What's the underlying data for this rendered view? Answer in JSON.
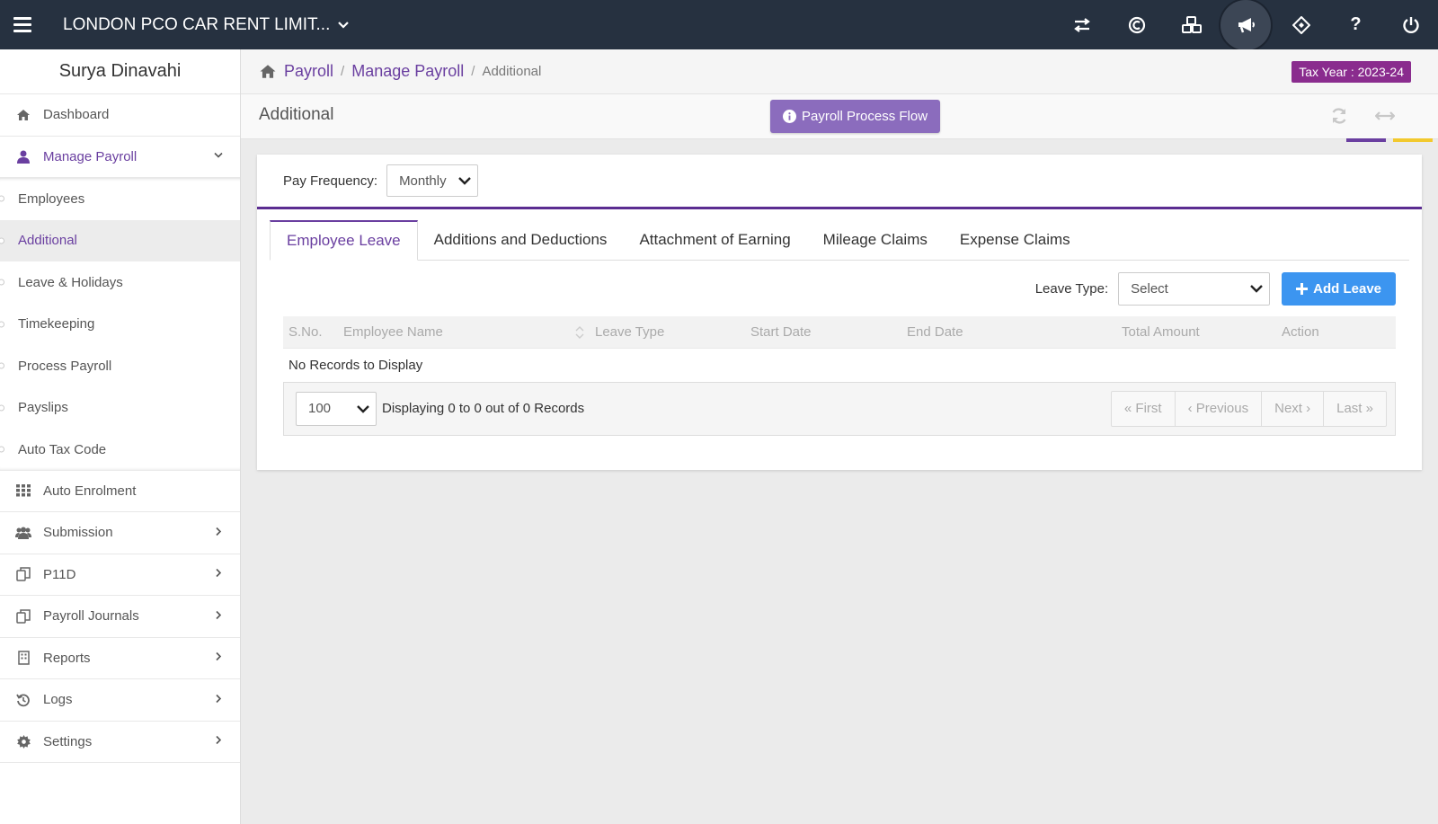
{
  "topbar": {
    "company": "LONDON PCO CAR RENT LIMIT...",
    "icons": [
      "transfer-icon",
      "copyright-icon",
      "cubes-icon",
      "bullhorn-icon",
      "ticket-icon",
      "question-icon",
      "power-icon"
    ]
  },
  "sidebar": {
    "user": "Surya Dinavahi",
    "dashboard": "Dashboard",
    "manage_payroll": "Manage Payroll",
    "sub": {
      "employees": "Employees",
      "additional": "Additional",
      "leave": "Leave & Holidays",
      "timekeeping": "Timekeeping",
      "process": "Process Payroll",
      "payslips": "Payslips",
      "autotax": "Auto Tax Code"
    },
    "auto_enrolment": "Auto Enrolment",
    "submission": "Submission",
    "p11d": "P11D",
    "journals": "Payroll Journals",
    "reports": "Reports",
    "logs": "Logs",
    "settings": "Settings"
  },
  "breadcrumb": {
    "payroll": "Payroll",
    "manage_payroll": "Manage Payroll",
    "current": "Additional",
    "separator": "/"
  },
  "tax_year": "Tax Year : 2023-24",
  "header": {
    "title": "Additional",
    "flow_button": "Payroll Process Flow"
  },
  "pay_frequency": {
    "label": "Pay Frequency:",
    "value": "Monthly"
  },
  "tabs": {
    "employee_leave": "Employee Leave",
    "add_ded": "Additions and Deductions",
    "attachment": "Attachment of Earning",
    "mileage": "Mileage Claims",
    "expense": "Expense Claims"
  },
  "leave_type": {
    "label": "Leave Type:",
    "value": "Select"
  },
  "add_leave": "Add Leave",
  "table": {
    "headers": {
      "sno": "S.No.",
      "name": "Employee Name",
      "type": "Leave Type",
      "start": "Start Date",
      "end": "End Date",
      "total": "Total Amount",
      "action": "Action"
    },
    "empty": "No Records to Display"
  },
  "pager": {
    "per_page": "100",
    "displaying": "Displaying 0 to 0 out of 0 Records",
    "first": "« First",
    "previous": "‹ Previous",
    "next": "Next ›",
    "last": "Last »"
  },
  "colors": {
    "topbar": "#263140",
    "accent": "#6a3fa0",
    "tax_badge": "#8a2c8e",
    "flow_button": "#8b6cbd",
    "add_button": "#3c95f0"
  }
}
